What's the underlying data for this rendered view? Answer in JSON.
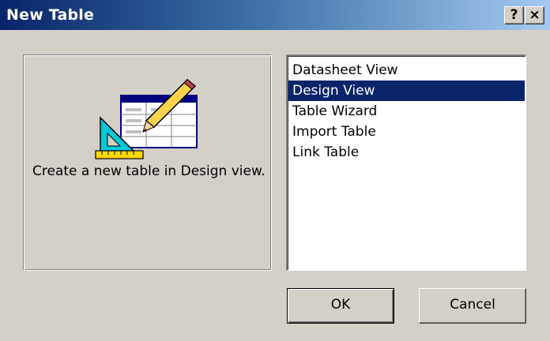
{
  "window": {
    "title": "New Table",
    "help_label": "?",
    "close_label": "×"
  },
  "preview": {
    "icon": "table-design-icon",
    "description": "Create a new table in Design view."
  },
  "list": {
    "items": [
      {
        "label": "Datasheet View",
        "selected": false
      },
      {
        "label": "Design View",
        "selected": true
      },
      {
        "label": "Table Wizard",
        "selected": false
      },
      {
        "label": "Import Table",
        "selected": false
      },
      {
        "label": "Link Table",
        "selected": false
      }
    ]
  },
  "buttons": {
    "ok_label": "OK",
    "cancel_label": "Cancel"
  },
  "colors": {
    "titlebar_start": "#0a246a",
    "titlebar_end": "#a6caf0",
    "selection": "#0a246a",
    "face": "#d4d0c8"
  }
}
